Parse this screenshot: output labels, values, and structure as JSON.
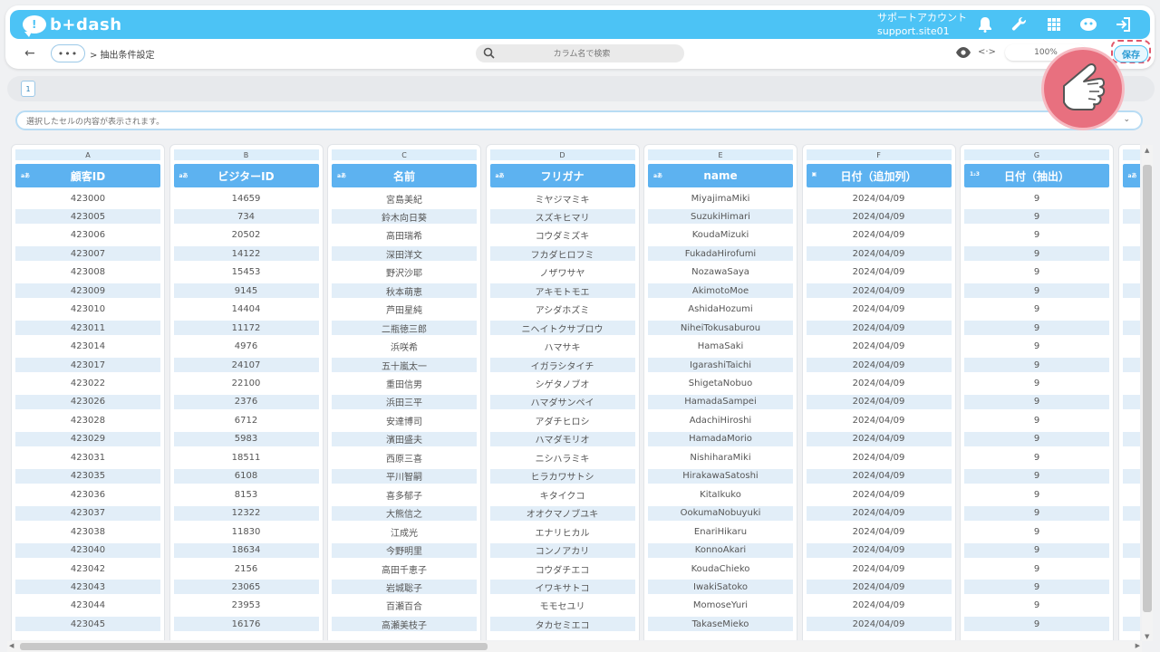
{
  "header": {
    "logo_text": "b+dash",
    "logo_bubble": "!",
    "account_name": "サポートアカウント",
    "account_site": "support.site01",
    "icons": [
      "bell-icon",
      "wrench-icon",
      "grid-icon",
      "robot-icon",
      "logout-icon"
    ]
  },
  "subbar": {
    "more_label": "•••",
    "breadcrumb": "> 抽出条件設定",
    "search_placeholder": "カラム名で検索",
    "code_label": "<·>",
    "zoom": "100%",
    "save_label": "保存"
  },
  "pagination": {
    "page": "1"
  },
  "cellbar": {
    "placeholder": "選択したセルの内容が表示されます。",
    "chevron": "⌄"
  },
  "colors": {
    "primary": "#4cc3f5",
    "header": "#5db2f0",
    "alt_row": "#e2eef8",
    "highlight": "#e0566a"
  },
  "columns": [
    {
      "letter": "A",
      "title": "顧客ID",
      "type": "aあ",
      "values": [
        "423000",
        "423005",
        "423006",
        "423007",
        "423008",
        "423009",
        "423010",
        "423011",
        "423014",
        "423017",
        "423022",
        "423026",
        "423028",
        "423029",
        "423031",
        "423035",
        "423036",
        "423037",
        "423038",
        "423040",
        "423042",
        "423043",
        "423044",
        "423045"
      ]
    },
    {
      "letter": "B",
      "title": "ビジターID",
      "type": "aあ",
      "values": [
        "14659",
        "734",
        "20502",
        "14122",
        "15453",
        "9145",
        "14404",
        "11172",
        "4976",
        "24107",
        "22100",
        "2376",
        "6712",
        "5983",
        "18511",
        "6108",
        "8153",
        "12322",
        "11830",
        "18634",
        "2156",
        "23065",
        "23953",
        "16176"
      ]
    },
    {
      "letter": "C",
      "title": "名前",
      "type": "aあ",
      "values": [
        "宮島美紀",
        "鈴木向日葵",
        "高田瑞希",
        "深田洋文",
        "野沢沙耶",
        "秋本萌恵",
        "芦田星純",
        "二瓶徳三郎",
        "浜咲希",
        "五十嵐太一",
        "重田信男",
        "浜田三平",
        "安達博司",
        "濱田盛夫",
        "西原三喜",
        "平川智嗣",
        "喜多郁子",
        "大熊信之",
        "江成光",
        "今野明里",
        "高田千恵子",
        "岩城聡子",
        "百瀬百合",
        "高瀬美枝子"
      ]
    },
    {
      "letter": "D",
      "title": "フリガナ",
      "type": "aあ",
      "values": [
        "ミヤジマミキ",
        "スズキヒマリ",
        "コウダミズキ",
        "フカダヒロフミ",
        "ノザワサヤ",
        "アキモトモエ",
        "アシダホズミ",
        "ニヘイトクサブロウ",
        "ハマサキ",
        "イガラシタイチ",
        "シゲタノブオ",
        "ハマダサンペイ",
        "アダチヒロシ",
        "ハマダモリオ",
        "ニシハラミキ",
        "ヒラカワサトシ",
        "キタイクコ",
        "オオクマノブユキ",
        "エナリヒカル",
        "コンノアカリ",
        "コウダチエコ",
        "イワキサトコ",
        "モモセユリ",
        "タカセミエコ"
      ]
    },
    {
      "letter": "E",
      "title": "name",
      "type": "aあ",
      "values": [
        "MiyajimaMiki",
        "SuzukiHimari",
        "KoudaMizuki",
        "FukadaHirofumi",
        "NozawaSaya",
        "AkimotoMoe",
        "AshidaHozumi",
        "NiheiTokusaburou",
        "HamaSaki",
        "IgarashiTaichi",
        "ShigetaNobuo",
        "HamadaSampei",
        "AdachiHiroshi",
        "HamadaMorio",
        "NishiharaMiki",
        "HirakawaSatoshi",
        "KitaIkuko",
        "OokumaNobuyuki",
        "EnariHikaru",
        "KonnoAkari",
        "KoudaChieko",
        "IwakiSatoko",
        "MomoseYuri",
        "TakaseMieko"
      ]
    },
    {
      "letter": "F",
      "title": "日付（追加列）",
      "type": "▣",
      "values": [
        "2024/04/09",
        "2024/04/09",
        "2024/04/09",
        "2024/04/09",
        "2024/04/09",
        "2024/04/09",
        "2024/04/09",
        "2024/04/09",
        "2024/04/09",
        "2024/04/09",
        "2024/04/09",
        "2024/04/09",
        "2024/04/09",
        "2024/04/09",
        "2024/04/09",
        "2024/04/09",
        "2024/04/09",
        "2024/04/09",
        "2024/04/09",
        "2024/04/09",
        "2024/04/09",
        "2024/04/09",
        "2024/04/09",
        "2024/04/09"
      ]
    },
    {
      "letter": "G",
      "title": "日付（抽出）",
      "type": "1₂3",
      "values": [
        "9",
        "9",
        "9",
        "9",
        "9",
        "9",
        "9",
        "9",
        "9",
        "9",
        "9",
        "9",
        "9",
        "9",
        "9",
        "9",
        "9",
        "9",
        "9",
        "9",
        "9",
        "9",
        "9",
        "9"
      ]
    },
    {
      "letter": "",
      "title": "",
      "type": "aあ",
      "values": [
        "",
        "",
        "",
        "",
        "",
        "",
        "",
        "",
        "",
        "",
        "",
        "",
        "",
        "",
        "",
        "",
        "",
        "",
        "",
        "",
        "",
        "",
        "",
        ""
      ]
    }
  ]
}
